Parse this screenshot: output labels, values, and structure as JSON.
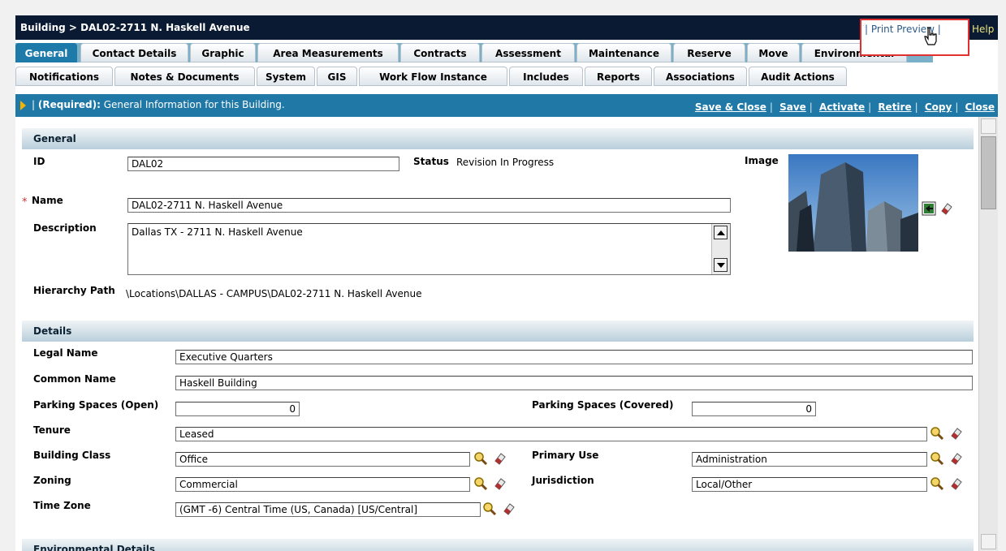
{
  "titlebar": {
    "title": "Building > DAL02-2711 N. Haskell Avenue",
    "print_preview": "| Print Preview |",
    "help": "Help"
  },
  "tabs_row1": [
    "General",
    "Contact Details",
    "Graphic",
    "Area Measurements",
    "Contracts",
    "Assessment",
    "Maintenance",
    "Reserve",
    "Move",
    "Environmental"
  ],
  "tabs_row2": [
    "Notifications",
    "Notes & Documents",
    "System",
    "GIS",
    "Work Flow Instance",
    "Includes",
    "Reports",
    "Associations",
    "Audit Actions"
  ],
  "infobar": {
    "required": "(Required):",
    "text": "General Information for this Building.",
    "actions": [
      "Save & Close",
      "Save",
      "Activate",
      "Retire",
      "Copy",
      "Close"
    ]
  },
  "general": {
    "section_title": "General",
    "id_label": "ID",
    "id_value": "DAL02",
    "status_label": "Status",
    "status_value": "Revision In Progress",
    "image_label": "Image",
    "name_label": "Name",
    "name_value": "DAL02-2711 N. Haskell Avenue",
    "description_label": "Description",
    "description_value": "Dallas TX - 2711 N. Haskell Avenue",
    "hierarchy_label": "Hierarchy Path",
    "hierarchy_value": "\\Locations\\DALLAS - CAMPUS\\DAL02-2711 N. Haskell Avenue"
  },
  "details": {
    "section_title": "Details",
    "legal_name_label": "Legal Name",
    "legal_name_value": "Executive Quarters",
    "common_name_label": "Common Name",
    "common_name_value": "Haskell Building",
    "parking_open_label": "Parking Spaces (Open)",
    "parking_open_value": "0",
    "parking_covered_label": "Parking Spaces (Covered)",
    "parking_covered_value": "0",
    "tenure_label": "Tenure",
    "tenure_value": "Leased",
    "building_class_label": "Building Class",
    "building_class_value": "Office",
    "primary_use_label": "Primary Use",
    "primary_use_value": "Administration",
    "zoning_label": "Zoning",
    "zoning_value": "Commercial",
    "jurisdiction_label": "Jurisdiction",
    "jurisdiction_value": "Local/Other",
    "time_zone_label": "Time Zone",
    "time_zone_value": "(GMT -6) Central Time (US, Canada) [US/Central]"
  },
  "environmental": {
    "section_title": "Environmental Details"
  },
  "colors": {
    "titlebar_bg": "#0b1a33",
    "tab_active": "#1e7aa8",
    "infobar_bg": "#1f78a6",
    "section_bg": "#b9cfdc",
    "highlight": "#e03030"
  },
  "icons": {
    "search": "magnifier-icon",
    "clear": "eraser-icon",
    "upload": "upload-image-icon"
  }
}
